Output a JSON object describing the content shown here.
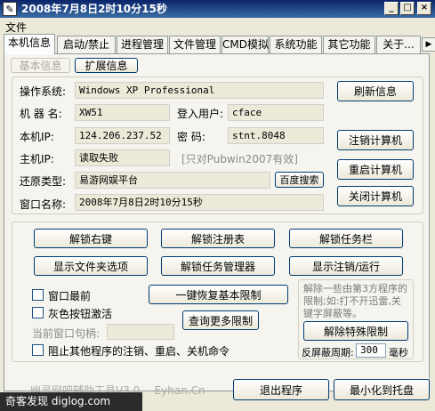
{
  "window": {
    "title": "2008年7月8日2时10分15秒",
    "min": "_",
    "max": "□",
    "close": "×"
  },
  "menu": {
    "file": "文件"
  },
  "tabs": [
    "本机信息",
    "启动/禁止",
    "进程管理",
    "文件管理",
    "CMD模拟",
    "系统功能",
    "其它功能",
    "关于..."
  ],
  "subtabs": {
    "basic": "基本信息",
    "extended": "扩展信息"
  },
  "info": {
    "os_label": "操作系统:",
    "os_value": "Windows XP Professional",
    "machine_label": "机 器 名:",
    "machine_value": "XW51",
    "user_label": "登入用户:",
    "user_value": "cface",
    "ip_label": "本机IP:",
    "ip_value": "124.206.237.52",
    "pwd_label": "密    码:",
    "pwd_value": "stnt.8048",
    "host_ip_label": "主机IP:",
    "host_ip_value": "读取失败",
    "host_ip_note": "[只对Pubwin2007有效]",
    "restore_label": "还原类型:",
    "restore_value": "易游网娱平台",
    "window_label": "窗口名称:",
    "window_value": "2008年7月8日2时10分15秒"
  },
  "buttons": {
    "refresh": "刷新信息",
    "baidu": "百度搜索",
    "logoff": "注销计算机",
    "restart": "重启计算机",
    "shutdown": "关闭计算机",
    "unlock_right": "解锁右键",
    "unlock_registry": "解锁注册表",
    "unlock_taskbar": "解锁任务栏",
    "show_folder_options": "显示文件夹选项",
    "unlock_taskmgr": "解锁任务管理器",
    "show_logoff_run": "显示注销/运行",
    "restore_limits": "一键恢复基本限制",
    "query_more": "查询更多限制",
    "remove_special": "解除特殊限制",
    "exit": "退出程序",
    "minimize_tray": "最小化到托盘"
  },
  "options": {
    "topmost": "窗口最前",
    "gray_activate": "灰色按钮激活",
    "current_handle_label": "当前窗口句柄:",
    "current_handle_value": "",
    "block_others": "阻止其他程序的注销、重启、关机命令"
  },
  "special_note": "解除一些由第3方程序的限制;如:打不开迅雷,关键字屏蔽等。",
  "interval": {
    "label": "反屏蔽周期:",
    "value": "300",
    "unit": "毫秒"
  },
  "status": {
    "text": "幽灵网吧辅助工具V3.0 -- Eyhan.Cn"
  },
  "watermark": {
    "text": "奇客发现 diglog.com"
  }
}
